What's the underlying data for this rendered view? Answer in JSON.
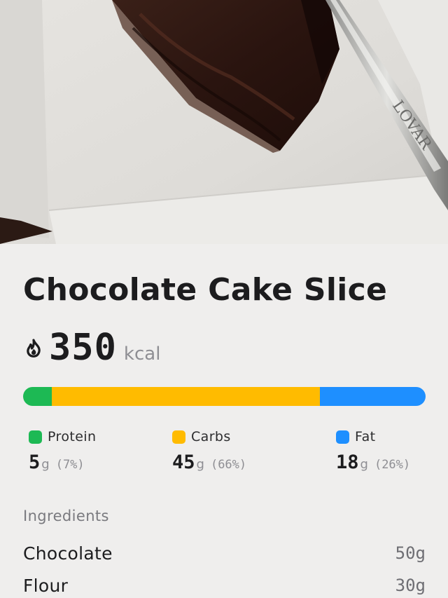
{
  "food": {
    "name": "Chocolate Cake Slice",
    "calories": "350",
    "calories_unit": "kcal"
  },
  "macro_bar": {
    "segments": [
      {
        "name": "Protein",
        "fraction": 0.07,
        "color": "#1db954"
      },
      {
        "name": "Carbs",
        "fraction": 0.66,
        "color": "#ffbb00"
      },
      {
        "name": "Fat",
        "fraction": 0.26,
        "color": "#1e8fff"
      }
    ]
  },
  "macros": [
    {
      "label": "Protein",
      "value": "5",
      "unit": "g",
      "percent": "(7%)",
      "color": "#1db954"
    },
    {
      "label": "Carbs",
      "value": "45",
      "unit": "g",
      "percent": "(66%)",
      "color": "#ffbb00"
    },
    {
      "label": "Fat",
      "value": "18",
      "unit": "g",
      "percent": "(26%)",
      "color": "#1e8fff"
    }
  ],
  "ingredients": {
    "heading": "Ingredients",
    "items": [
      {
        "name": "Chocolate",
        "amount": "50g"
      },
      {
        "name": "Flour",
        "amount": "30g"
      }
    ]
  },
  "icons": {
    "calories": "flame-icon"
  },
  "photo": {
    "fork_engraving": "LOVAR"
  }
}
